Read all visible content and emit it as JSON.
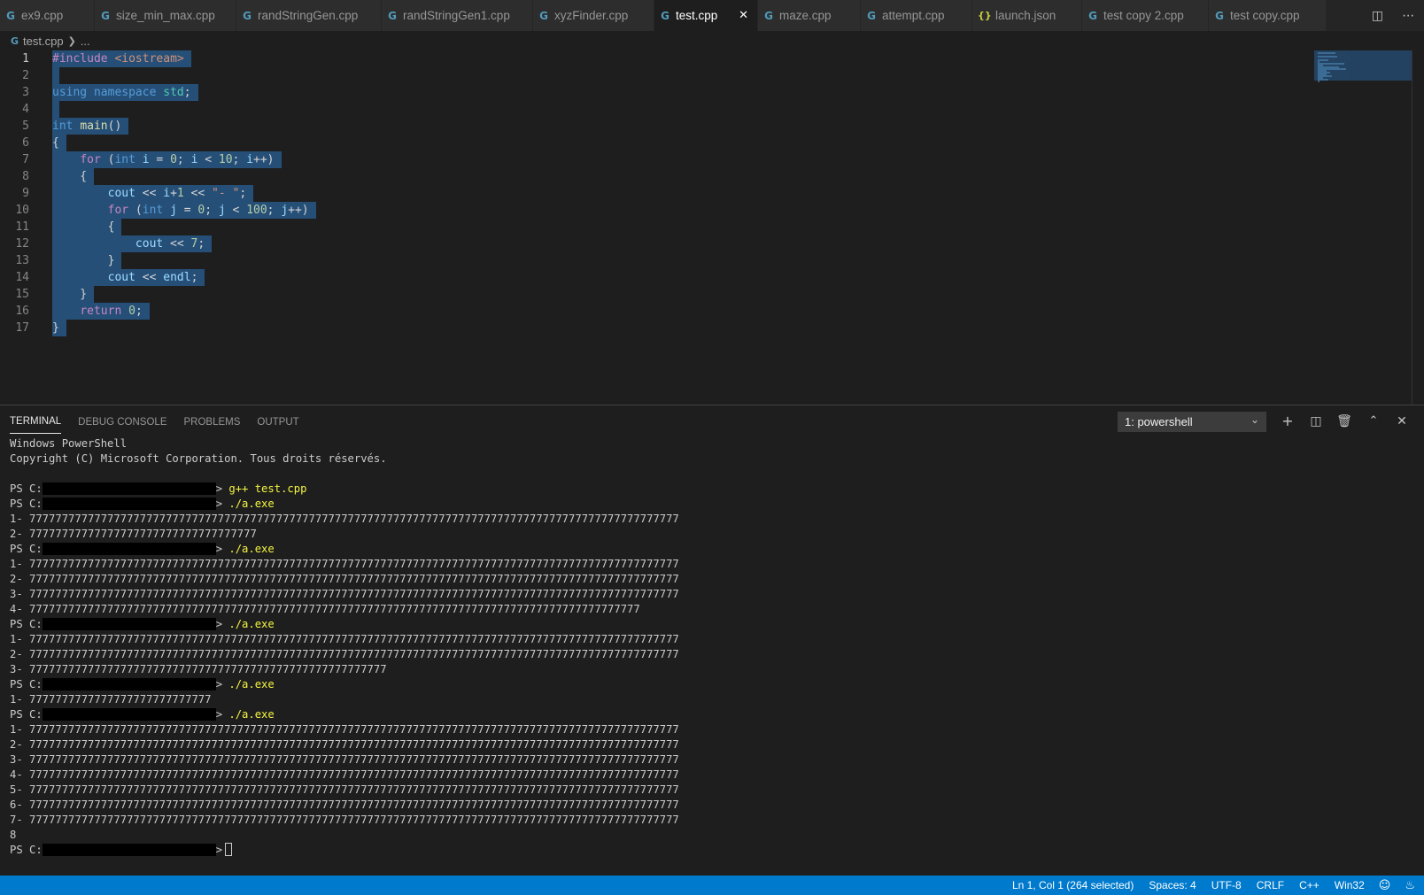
{
  "tabs": [
    {
      "label": "ex9.cpp",
      "icon": "cpp-icon",
      "active": false
    },
    {
      "label": "size_min_max.cpp",
      "icon": "cpp-icon",
      "active": false
    },
    {
      "label": "randStringGen.cpp",
      "icon": "cpp-icon",
      "active": false
    },
    {
      "label": "randStringGen1.cpp",
      "icon": "cpp-icon",
      "active": false
    },
    {
      "label": "xyzFinder.cpp",
      "icon": "cpp-icon",
      "active": false
    },
    {
      "label": "test.cpp",
      "icon": "cpp-icon",
      "active": true
    },
    {
      "label": "maze.cpp",
      "icon": "cpp-icon",
      "active": false
    },
    {
      "label": "attempt.cpp",
      "icon": "cpp-icon",
      "active": false
    },
    {
      "label": "launch.json",
      "icon": "json-icon",
      "active": false
    },
    {
      "label": "test copy 2.cpp",
      "icon": "cpp-icon",
      "active": false
    },
    {
      "label": "test copy.cpp",
      "icon": "cpp-icon",
      "active": false
    }
  ],
  "breadcrumb": {
    "file": "test.cpp",
    "rest": "..."
  },
  "editor": {
    "line_numbers": [
      "1",
      "2",
      "3",
      "4",
      "5",
      "6",
      "7",
      "8",
      "9",
      "10",
      "11",
      "12",
      "13",
      "14",
      "15",
      "16",
      "17"
    ],
    "lines": [
      "#include <iostream>",
      "",
      "using namespace std;",
      "",
      "int main()",
      "{",
      "    for (int i = 0; i < 10; i++)",
      "    {",
      "        cout << i+1 << \"- \";",
      "        for (int j = 0; j < 100; j++)",
      "        {",
      "            cout << 7;",
      "        }",
      "        cout << endl;",
      "    }",
      "    return 0;",
      "}"
    ]
  },
  "panel": {
    "tabs": [
      "TERMINAL",
      "DEBUG CONSOLE",
      "PROBLEMS",
      "OUTPUT"
    ],
    "terminal_select": "1: powershell"
  },
  "terminal": {
    "header1": "Windows PowerShell",
    "header2": "Copyright (C) Microsoft Corporation. Tous droits réservés.",
    "prompt_prefix": "PS C:",
    "prompt_suffix": ">",
    "cmd_compile": " g++ test.cpp",
    "cmd_run": " ./a.exe",
    "run1": [
      "1- 7777777777777777777777777777777777777777777777777777777777777777777777777777777777777777777777777777",
      "2- 77777777777777777777777777777777777"
    ],
    "run2": [
      "1- 7777777777777777777777777777777777777777777777777777777777777777777777777777777777777777777777777777",
      "2- 7777777777777777777777777777777777777777777777777777777777777777777777777777777777777777777777777777",
      "3- 7777777777777777777777777777777777777777777777777777777777777777777777777777777777777777777777777777",
      "4- 7777777777777777777777777777777777777777777777777777777777777777777777777777777777777777777777"
    ],
    "run3": [
      "1- 7777777777777777777777777777777777777777777777777777777777777777777777777777777777777777777777777777",
      "2- 7777777777777777777777777777777777777777777777777777777777777777777777777777777777777777777777777777",
      "3- 7777777777777777777777777777777777777777777777777777777"
    ],
    "run4": [
      "1- 7777777777777777777777777777"
    ],
    "run5": [
      "1- 7777777777777777777777777777777777777777777777777777777777777777777777777777777777777777777777777777",
      "2- 7777777777777777777777777777777777777777777777777777777777777777777777777777777777777777777777777777",
      "3- 7777777777777777777777777777777777777777777777777777777777777777777777777777777777777777777777777777",
      "4- 7777777777777777777777777777777777777777777777777777777777777777777777777777777777777777777777777777",
      "5- 7777777777777777777777777777777777777777777777777777777777777777777777777777777777777777777777777777",
      "6- 7777777777777777777777777777777777777777777777777777777777777777777777777777777777777777777777777777",
      "7- 7777777777777777777777777777777777777777777777777777777777777777777777777777777777777777777777777777",
      "8"
    ]
  },
  "statusbar": {
    "position": "Ln 1, Col 1 (264 selected)",
    "spaces": "Spaces: 4",
    "encoding": "UTF-8",
    "eol": "CRLF",
    "language": "C++",
    "platform": "Win32"
  },
  "colors": {
    "statusbar": "#007acc",
    "selection": "#264f78",
    "editor_bg": "#1e1e1e"
  }
}
